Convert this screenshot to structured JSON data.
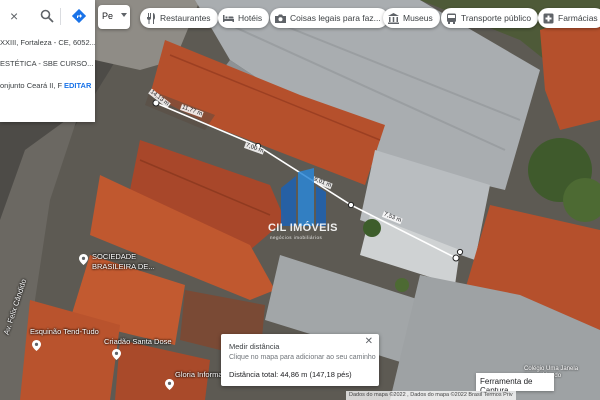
{
  "search_panel": {
    "result_1": "XXIII, Fortaleza - CE, 6052...",
    "result_2": "ESTÉTICA - SBE CURSO...",
    "result_3": "onjunto Ceará II, F...",
    "edit_label": "EDITAR"
  },
  "mini_input": {
    "value": "Pe"
  },
  "chips": [
    {
      "label": "Restaurantes",
      "icon": "fork-knife-icon"
    },
    {
      "label": "Hotéis",
      "icon": "bed-icon"
    },
    {
      "label": "Coisas legais para faz...",
      "icon": "camera-icon"
    },
    {
      "label": "Museus",
      "icon": "museum-icon"
    },
    {
      "label": "Transporte público",
      "icon": "bus-icon"
    },
    {
      "label": "Farmácias",
      "icon": "pharmacy-icon"
    }
  ],
  "measure": {
    "segment_labels": [
      "14,13 m",
      "11,77 m",
      "7,00 m",
      "9,01 m",
      "7,53 m"
    ],
    "card_title": "Medir distância",
    "card_hint": "Clique no mapa para adicionar ao seu caminho",
    "total": "Distância total: 44,86 m (147,18 pés)"
  },
  "places": [
    {
      "name": "SOCIEDADE",
      "line2": "BRASILEIRA DE..."
    },
    {
      "name": "Esquinão Tend-Tudo"
    },
    {
      "name": "Criadão Santa Dose"
    },
    {
      "name": "Gloria Informatica"
    }
  ],
  "street": "Av. Felix Cândido",
  "watermark": "CIL IMÓVEIS",
  "watermark_sub": "negócios imobiliários",
  "corner_text": "Colégio Uma Janela\npara o Mundo",
  "attribution": "Dados do mapa ©2022 , Dados do mapa ©2022   Brasil   Termos   Priv",
  "capture_button": "Ferramenta de Captura",
  "colors": {
    "roof_red": "#b5502c",
    "roof_grey": "#a8acae",
    "link": "#1a73e8"
  }
}
